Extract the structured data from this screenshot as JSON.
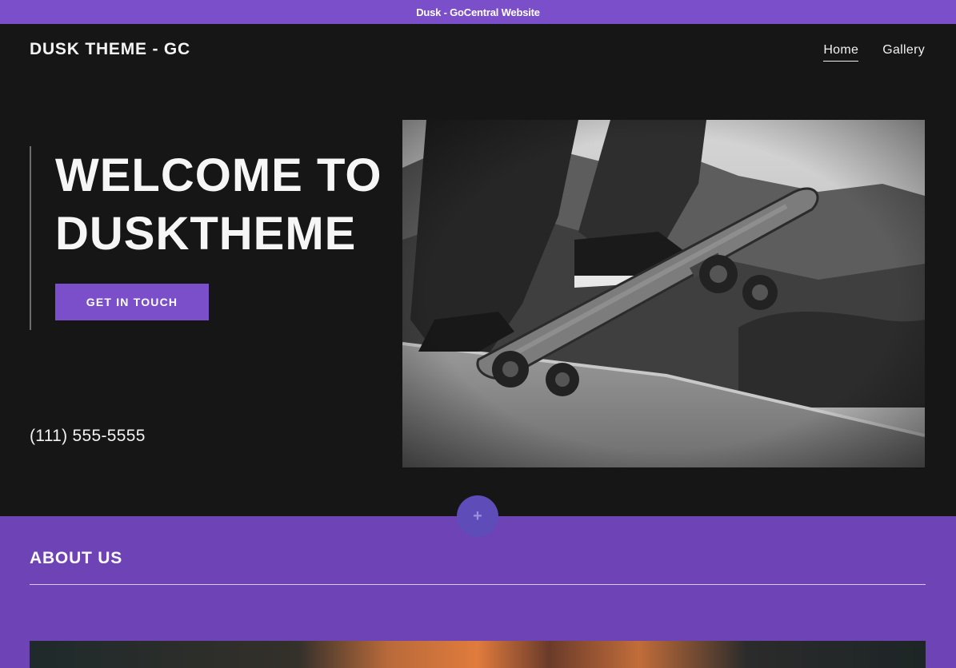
{
  "window": {
    "title": "Dusk - GoCentral Website"
  },
  "header": {
    "logo": "DUSK THEME - GC",
    "nav": [
      {
        "label": "Home",
        "active": true
      },
      {
        "label": "Gallery",
        "active": false
      }
    ]
  },
  "hero": {
    "headline_line1": "WELCOME TO",
    "headline_line2": "DUSKTHEME",
    "cta_label": "GET IN TOUCH",
    "phone": "(111) 555-5555",
    "image": "black-and-white skateboarder grinding on a ramp edge"
  },
  "editor": {
    "add_section_icon": "plus-icon",
    "add_section_glyph": "+"
  },
  "about": {
    "title": "ABOUT US",
    "image": "warm-toned blurred photo"
  },
  "colors": {
    "accent": "#7a4fc9",
    "about_bg": "#6e43b6",
    "hero_bg": "#161616"
  }
}
